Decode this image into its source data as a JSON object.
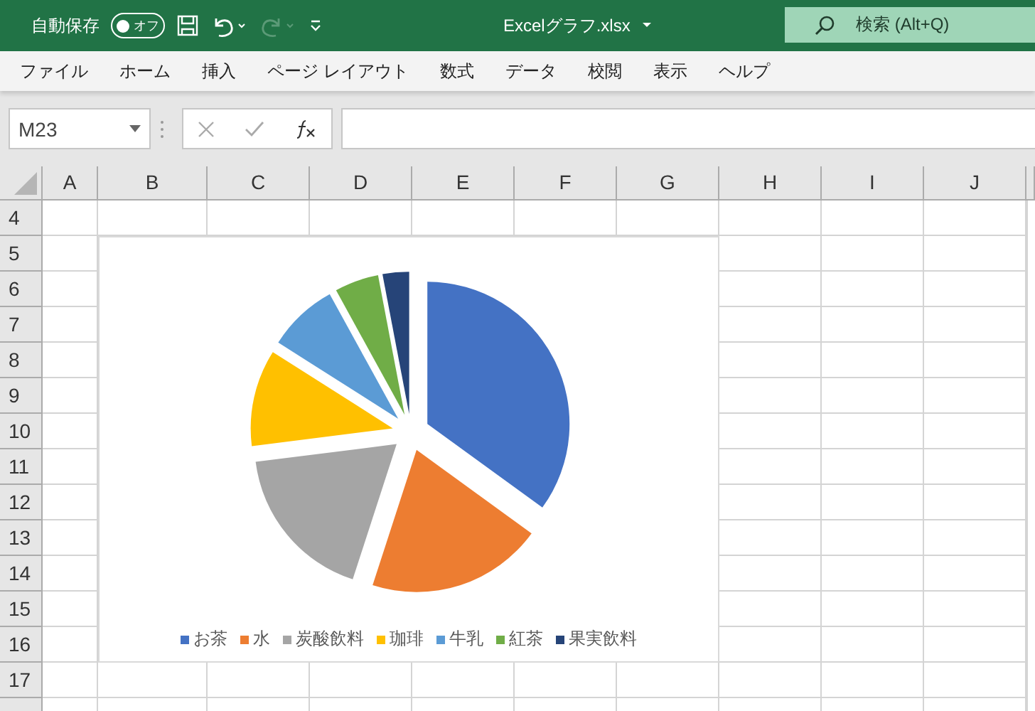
{
  "title_bar": {
    "autosave_label": "自動保存",
    "autosave": {
      "on": false,
      "label": "オフ"
    },
    "redo_disabled": true,
    "file_name": "Excelグラフ.xlsx",
    "search_placeholder": "検索 (Alt+Q)"
  },
  "ribbon_tabs": [
    "ファイル",
    "ホーム",
    "挿入",
    "ページ レイアウト",
    "数式",
    "データ",
    "校閲",
    "表示",
    "ヘルプ"
  ],
  "formula_bar": {
    "name_box": "M23"
  },
  "grid": {
    "columns": [
      "A",
      "B",
      "C",
      "D",
      "E",
      "F",
      "G",
      "H",
      "I",
      "J"
    ],
    "rows": [
      "4",
      "5",
      "6",
      "7",
      "8",
      "9",
      "10",
      "11",
      "12",
      "13",
      "14",
      "15",
      "16",
      "17"
    ]
  },
  "chart": {
    "legend": [
      {
        "label": "お茶",
        "color": "#4472c4"
      },
      {
        "label": "水",
        "color": "#ed7d31"
      },
      {
        "label": "炭酸飲料",
        "color": "#a5a5a5"
      },
      {
        "label": "珈琲",
        "color": "#ffc000"
      },
      {
        "label": "牛乳",
        "color": "#5b9bd5"
      },
      {
        "label": "紅茶",
        "color": "#70ad47"
      },
      {
        "label": "果実飲料",
        "color": "#264478"
      }
    ]
  }
}
